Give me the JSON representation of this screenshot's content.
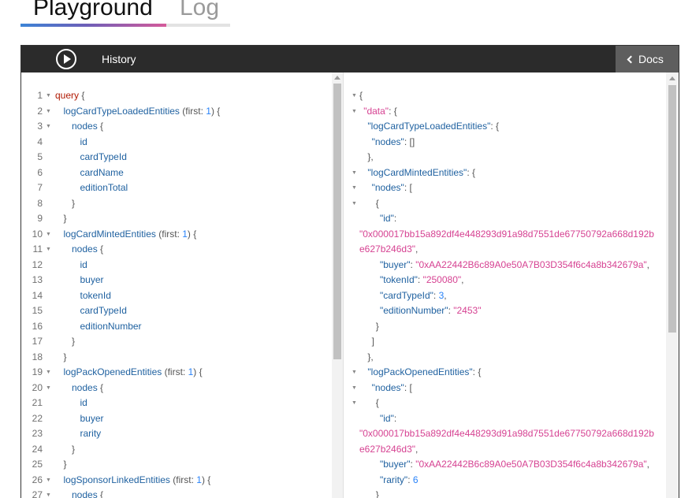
{
  "tabs": {
    "playground": "Playground",
    "log": "Log"
  },
  "toolbar": {
    "history": "History",
    "docs": "Docs"
  },
  "query_lines": [
    {
      "n": "1",
      "fold": true,
      "indent": 0,
      "parts": [
        [
          "kw",
          "query"
        ],
        [
          "txt",
          " {"
        ]
      ]
    },
    {
      "n": "2",
      "fold": true,
      "indent": 1,
      "parts": [
        [
          "fld",
          "logCardTypeLoadedEntities"
        ],
        [
          "txt",
          " (first: "
        ],
        [
          "num",
          "1"
        ],
        [
          "txt",
          ") {"
        ]
      ]
    },
    {
      "n": "3",
      "fold": true,
      "indent": 2,
      "parts": [
        [
          "fld",
          "nodes"
        ],
        [
          "txt",
          " {"
        ]
      ]
    },
    {
      "n": "4",
      "fold": false,
      "indent": 3,
      "parts": [
        [
          "fld",
          "id"
        ]
      ]
    },
    {
      "n": "5",
      "fold": false,
      "indent": 3,
      "parts": [
        [
          "fld",
          "cardTypeId"
        ]
      ]
    },
    {
      "n": "6",
      "fold": false,
      "indent": 3,
      "parts": [
        [
          "fld",
          "cardName"
        ]
      ]
    },
    {
      "n": "7",
      "fold": false,
      "indent": 3,
      "parts": [
        [
          "fld",
          "editionTotal"
        ]
      ]
    },
    {
      "n": "8",
      "fold": false,
      "indent": 2,
      "parts": [
        [
          "txt",
          "}"
        ]
      ]
    },
    {
      "n": "9",
      "fold": false,
      "indent": 1,
      "parts": [
        [
          "txt",
          "}"
        ]
      ]
    },
    {
      "n": "10",
      "fold": true,
      "indent": 1,
      "parts": [
        [
          "fld",
          "logCardMintedEntities"
        ],
        [
          "txt",
          " (first: "
        ],
        [
          "num",
          "1"
        ],
        [
          "txt",
          ") {"
        ]
      ]
    },
    {
      "n": "11",
      "fold": true,
      "indent": 2,
      "parts": [
        [
          "fld",
          "nodes"
        ],
        [
          "txt",
          " {"
        ]
      ]
    },
    {
      "n": "12",
      "fold": false,
      "indent": 3,
      "parts": [
        [
          "fld",
          "id"
        ]
      ]
    },
    {
      "n": "13",
      "fold": false,
      "indent": 3,
      "parts": [
        [
          "fld",
          "buyer"
        ]
      ]
    },
    {
      "n": "14",
      "fold": false,
      "indent": 3,
      "parts": [
        [
          "fld",
          "tokenId"
        ]
      ]
    },
    {
      "n": "15",
      "fold": false,
      "indent": 3,
      "parts": [
        [
          "fld",
          "cardTypeId"
        ]
      ]
    },
    {
      "n": "16",
      "fold": false,
      "indent": 3,
      "parts": [
        [
          "fld",
          "editionNumber"
        ]
      ]
    },
    {
      "n": "17",
      "fold": false,
      "indent": 2,
      "parts": [
        [
          "txt",
          "}"
        ]
      ]
    },
    {
      "n": "18",
      "fold": false,
      "indent": 1,
      "parts": [
        [
          "txt",
          "}"
        ]
      ]
    },
    {
      "n": "19",
      "fold": true,
      "indent": 1,
      "parts": [
        [
          "fld",
          "logPackOpenedEntities"
        ],
        [
          "txt",
          " (first: "
        ],
        [
          "num",
          "1"
        ],
        [
          "txt",
          ") {"
        ]
      ]
    },
    {
      "n": "20",
      "fold": true,
      "indent": 2,
      "parts": [
        [
          "fld",
          "nodes"
        ],
        [
          "txt",
          " {"
        ]
      ]
    },
    {
      "n": "21",
      "fold": false,
      "indent": 3,
      "parts": [
        [
          "fld",
          "id"
        ]
      ]
    },
    {
      "n": "22",
      "fold": false,
      "indent": 3,
      "parts": [
        [
          "fld",
          "buyer"
        ]
      ]
    },
    {
      "n": "23",
      "fold": false,
      "indent": 3,
      "parts": [
        [
          "fld",
          "rarity"
        ]
      ]
    },
    {
      "n": "24",
      "fold": false,
      "indent": 2,
      "parts": [
        [
          "txt",
          "}"
        ]
      ]
    },
    {
      "n": "25",
      "fold": false,
      "indent": 1,
      "parts": [
        [
          "txt",
          "}"
        ]
      ]
    },
    {
      "n": "26",
      "fold": true,
      "indent": 1,
      "parts": [
        [
          "fld",
          "logSponsorLinkedEntities"
        ],
        [
          "txt",
          " (first: "
        ],
        [
          "num",
          "1"
        ],
        [
          "txt",
          ") {"
        ]
      ]
    },
    {
      "n": "27",
      "fold": true,
      "indent": 2,
      "parts": [
        [
          "fld",
          "nodes"
        ],
        [
          "txt",
          " {"
        ]
      ]
    }
  ],
  "result_lines": [
    {
      "fold": true,
      "indent": 0,
      "parts": [
        [
          "txt",
          "{"
        ]
      ]
    },
    {
      "fold": true,
      "indent": 1,
      "parts": [
        [
          "str",
          "\"data\""
        ],
        [
          "txt",
          ": {"
        ]
      ]
    },
    {
      "fold": false,
      "indent": 2,
      "parts": [
        [
          "key",
          "\"logCardTypeLoadedEntities\""
        ],
        [
          "txt",
          ": {"
        ]
      ]
    },
    {
      "fold": false,
      "indent": 3,
      "parts": [
        [
          "key",
          "\"nodes\""
        ],
        [
          "txt",
          ": []"
        ]
      ]
    },
    {
      "fold": false,
      "indent": 2,
      "parts": [
        [
          "txt",
          "},"
        ]
      ]
    },
    {
      "fold": true,
      "indent": 2,
      "parts": [
        [
          "key",
          "\"logCardMintedEntities\""
        ],
        [
          "txt",
          ": {"
        ]
      ]
    },
    {
      "fold": true,
      "indent": 3,
      "parts": [
        [
          "key",
          "\"nodes\""
        ],
        [
          "txt",
          ": ["
        ]
      ]
    },
    {
      "fold": true,
      "indent": 4,
      "parts": [
        [
          "txt",
          "{"
        ]
      ]
    },
    {
      "fold": false,
      "indent": 5,
      "parts": [
        [
          "key",
          "\"id\""
        ],
        [
          "txt",
          ":"
        ]
      ]
    },
    {
      "fold": false,
      "indent": 0,
      "parts": [
        [
          "str",
          "\"0x000017bb15a892df4e448293d91a98d7551de67750792a668d192b"
        ]
      ]
    },
    {
      "fold": false,
      "indent": 0,
      "parts": [
        [
          "str",
          "e627b246d3\""
        ],
        [
          "txt",
          ","
        ]
      ]
    },
    {
      "fold": false,
      "indent": 5,
      "parts": [
        [
          "key",
          "\"buyer\""
        ],
        [
          "txt",
          ": "
        ],
        [
          "str",
          "\"0xAA22442B6c89A0e50A7B03D354f6c4a8b342679a\""
        ],
        [
          "txt",
          ","
        ]
      ]
    },
    {
      "fold": false,
      "indent": 5,
      "parts": [
        [
          "key",
          "\"tokenId\""
        ],
        [
          "txt",
          ": "
        ],
        [
          "str",
          "\"250080\""
        ],
        [
          "txt",
          ","
        ]
      ]
    },
    {
      "fold": false,
      "indent": 5,
      "parts": [
        [
          "key",
          "\"cardTypeId\""
        ],
        [
          "txt",
          ": "
        ],
        [
          "num",
          "3"
        ],
        [
          "txt",
          ","
        ]
      ]
    },
    {
      "fold": false,
      "indent": 5,
      "parts": [
        [
          "key",
          "\"editionNumber\""
        ],
        [
          "txt",
          ": "
        ],
        [
          "str",
          "\"2453\""
        ]
      ]
    },
    {
      "fold": false,
      "indent": 4,
      "parts": [
        [
          "txt",
          "}"
        ]
      ]
    },
    {
      "fold": false,
      "indent": 3,
      "parts": [
        [
          "txt",
          "]"
        ]
      ]
    },
    {
      "fold": false,
      "indent": 2,
      "parts": [
        [
          "txt",
          "},"
        ]
      ]
    },
    {
      "fold": true,
      "indent": 2,
      "parts": [
        [
          "key",
          "\"logPackOpenedEntities\""
        ],
        [
          "txt",
          ": {"
        ]
      ]
    },
    {
      "fold": true,
      "indent": 3,
      "parts": [
        [
          "key",
          "\"nodes\""
        ],
        [
          "txt",
          ": ["
        ]
      ]
    },
    {
      "fold": true,
      "indent": 4,
      "parts": [
        [
          "txt",
          "{"
        ]
      ]
    },
    {
      "fold": false,
      "indent": 5,
      "parts": [
        [
          "key",
          "\"id\""
        ],
        [
          "txt",
          ":"
        ]
      ]
    },
    {
      "fold": false,
      "indent": 0,
      "parts": [
        [
          "str",
          "\"0x000017bb15a892df4e448293d91a98d7551de67750792a668d192b"
        ]
      ]
    },
    {
      "fold": false,
      "indent": 0,
      "parts": [
        [
          "str",
          "e627b246d3\""
        ],
        [
          "txt",
          ","
        ]
      ]
    },
    {
      "fold": false,
      "indent": 5,
      "parts": [
        [
          "key",
          "\"buyer\""
        ],
        [
          "txt",
          ": "
        ],
        [
          "str",
          "\"0xAA22442B6c89A0e50A7B03D354f6c4a8b342679a\""
        ],
        [
          "txt",
          ","
        ]
      ]
    },
    {
      "fold": false,
      "indent": 5,
      "parts": [
        [
          "key",
          "\"rarity\""
        ],
        [
          "txt",
          ": "
        ],
        [
          "num",
          "6"
        ]
      ]
    },
    {
      "fold": false,
      "indent": 4,
      "parts": [
        [
          "txt",
          "}"
        ]
      ]
    }
  ],
  "icons": {
    "play": "play-icon",
    "docs": "chevron-left-icon",
    "fold": "fold-arrow-icon"
  },
  "colors": {
    "keyword": "#b11a04",
    "field": "#1f61a0",
    "number": "#2882f9",
    "string": "#d64292",
    "toolbar": "#2b2b2b"
  }
}
